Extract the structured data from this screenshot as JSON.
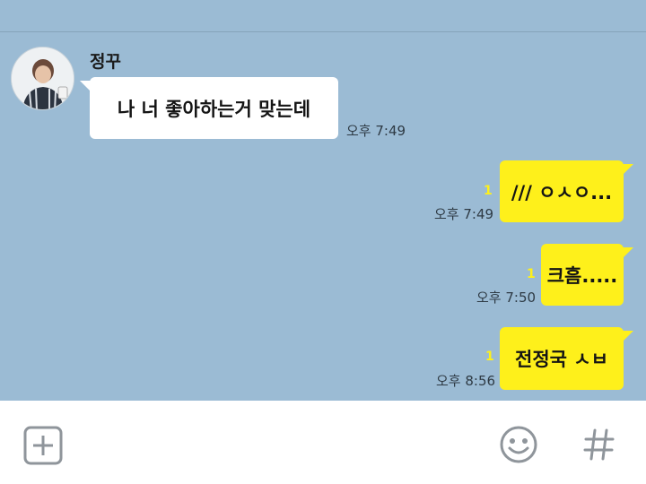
{
  "contact": {
    "name": "정꾸"
  },
  "messages": [
    {
      "text": "나 너 좋아하는거 맞는데",
      "time": "오후 7:49",
      "unread": ""
    },
    {
      "text": "/// ㅇㅅㅇ...",
      "time": "오후 7:49",
      "unread": "1"
    },
    {
      "text": "크흠.....",
      "time": "오후 7:50",
      "unread": "1"
    },
    {
      "text": "전정국 ㅅㅂ",
      "time": "오후 8:56",
      "unread": "1"
    }
  ],
  "input_bar": {
    "icons": [
      "plus-icon",
      "emoticon-icon",
      "hash-icon"
    ]
  },
  "colors": {
    "background": "#9bbbd4",
    "my_bubble": "#fef01b",
    "their_bubble": "#ffffff",
    "unread_count": "#fef01b"
  }
}
